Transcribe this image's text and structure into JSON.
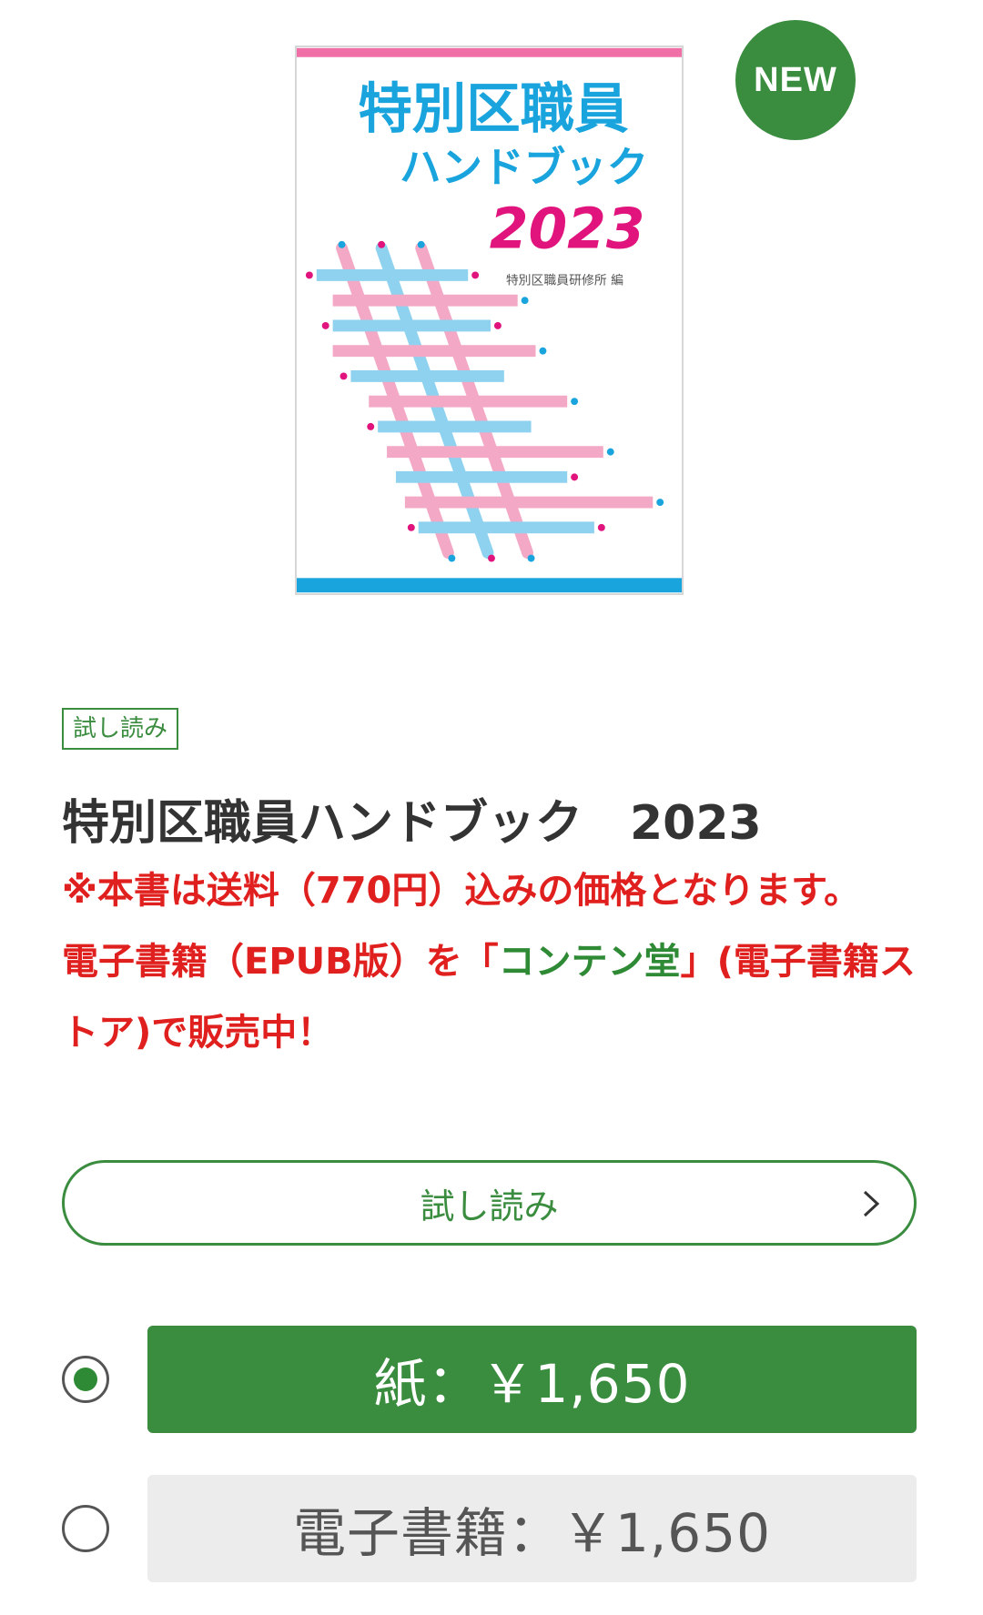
{
  "product": {
    "new_badge": "NEW",
    "cover": {
      "title_line1": "特別区職員",
      "title_line2": "ハンドブック",
      "title_year": "2023",
      "editor": "特別区職員研修所 編"
    },
    "trial_tag": "試し読み",
    "title": "特別区職員ハンドブック　2023",
    "notice": {
      "line1": "※本書は送料（770円）込みの価格となります。",
      "line2_prefix": "電子書籍（EPUB版）を「",
      "store_link": "コンテン堂",
      "line2_suffix": "」(電子書籍ストア)で販売中！"
    },
    "trial_button_label": "試し読み",
    "options": [
      {
        "label": "紙：￥1,650",
        "selected": true
      },
      {
        "label": "電子書籍：￥1,650",
        "selected": false
      }
    ]
  },
  "colors": {
    "brand_green": "#3a8c3f",
    "notice_red": "#e0201e",
    "cover_pink": "#f3a9c6",
    "cover_blue": "#8fd2ef",
    "cover_title_blue": "#1aa4dd",
    "cover_year_magenta": "#e0147c"
  },
  "icons": {
    "trial_chevron": "chevron-right-icon",
    "radio_selected": "radio-checked-icon",
    "radio_unselected": "radio-unchecked-icon"
  }
}
